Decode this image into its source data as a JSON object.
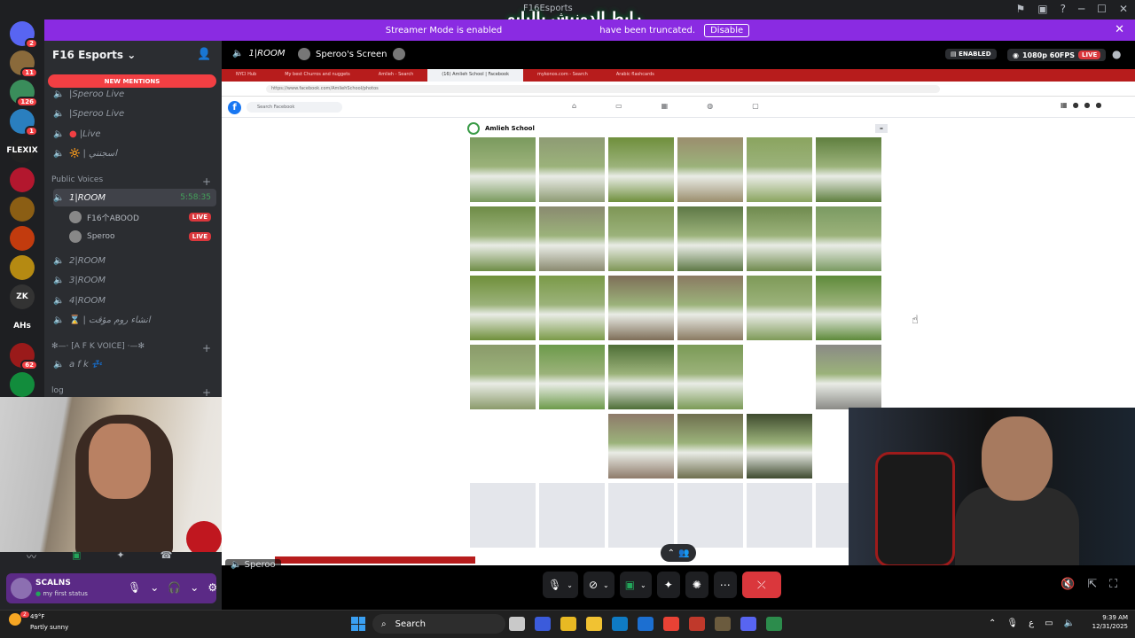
{
  "window": {
    "title": "F16Esports",
    "overlay_logo_text": "رابط الدونيش بالبايو",
    "controls": [
      "inbox-icon",
      "help-icon",
      "minimize",
      "maximize",
      "close"
    ]
  },
  "streamer_mode": {
    "text": "Streamer Mode is enabled. Sensitive details have been truncated.",
    "text_left": "Streamer Mode is enabled",
    "text_right": "have been truncated.",
    "disable_label": "Disable"
  },
  "server_rail": [
    {
      "name": "discord-home",
      "badge": "2",
      "color": "#5865f2"
    },
    {
      "name": "server-1",
      "badge": "11",
      "color": "#8a6a3b"
    },
    {
      "name": "server-2",
      "badge": "126",
      "color": "#3a8d5b"
    },
    {
      "name": "server-3",
      "badge": "1",
      "color": "#2a7fbf"
    },
    {
      "name": "server-4",
      "badge": "",
      "color": "#222222",
      "label": "FLEXIX"
    },
    {
      "name": "server-5",
      "badge": "",
      "color": "#b3172e"
    },
    {
      "name": "server-6",
      "badge": "",
      "color": "#8b5e14"
    },
    {
      "name": "server-7",
      "badge": "",
      "color": "#c23b0e"
    },
    {
      "name": "server-8",
      "badge": "",
      "color": "#b58a12"
    },
    {
      "name": "server-9",
      "badge": "",
      "color": "#333333",
      "label": "ZK"
    },
    {
      "name": "server-10",
      "badge": "",
      "color": "#1e1f22",
      "label": "AHs"
    },
    {
      "name": "server-11",
      "badge": "62",
      "color": "#9a1a1a"
    },
    {
      "name": "server-12",
      "badge": "",
      "color": "#128c3c"
    }
  ],
  "sidebar": {
    "server_name": "F16 Esports",
    "new_mentions": "NEW MENTIONS",
    "channels_top": [
      {
        "label": "|Speroo Live"
      },
      {
        "label": "|Speroo Live"
      },
      {
        "label": "|Live"
      },
      {
        "label": "| اسجنني"
      }
    ],
    "category_public": "Public Voices",
    "active_channel": {
      "label": "1|ROOM",
      "timer": "5:58:35"
    },
    "voice_users": [
      {
        "name": "F16个ABOOD",
        "live": "LIVE"
      },
      {
        "name": "Speroo",
        "live": "LIVE"
      }
    ],
    "rooms": [
      "2|ROOM",
      "3|ROOM",
      "4|ROOM",
      "| انشاء روم مؤقت"
    ],
    "category_afk": "✻—· [A F K VOICE] ·—✻",
    "afk_channel": "a f k",
    "category_log": "log"
  },
  "voice_header": {
    "room": "1|ROOM",
    "screen_label": "Speroo's Screen",
    "enabled_badge": "ENABLED",
    "quality": "1080p 60FPS",
    "live": "LIVE"
  },
  "browser": {
    "tabs": [
      "NYCI Hub",
      "My best Churros and nuggets",
      "Amlieh - Search",
      "(16) Amlieh School | Facebook",
      "mykonos.com - Search",
      "Arabic flashcards"
    ],
    "url": "https://www.facebook.com/AmliehSchool/photos",
    "fb_search_placeholder": "Search Facebook",
    "page_name": "Amlieh School"
  },
  "photos": {
    "rows": [
      [
        "#7a9a5e",
        "#8e9b74",
        "#6f8f3c",
        "#9b8e6e",
        "#8aa45f",
        "#5f7f3f"
      ],
      [
        "#6e8c46",
        "#8a8a70",
        "#7e9656",
        "#5e7846",
        "#6f8a4e",
        "#7a9a62"
      ],
      [
        "#6f8f3a",
        "#7a9a48",
        "#7e6e58",
        "#8a7a62",
        "#7e9a58",
        "#5e8a3a"
      ],
      [
        "#8a9a6a",
        "#6c9a4a",
        "#4e6e36",
        "#7a9a56",
        "",
        "#8a8a86"
      ],
      [
        "",
        "",
        "#8e7a6a",
        "#6e6e4e",
        "#3e4a2e",
        ""
      ]
    ],
    "skeleton_count": 6
  },
  "stream_footer": {
    "user_tag": "Speroo"
  },
  "user_panel": {
    "name": "SCALNS",
    "status": "my first status"
  },
  "taskbar": {
    "temperature": "49°F",
    "weather": "Partly sunny",
    "weather_badge": "2",
    "search_label": "Search",
    "apps": [
      "#c9c9c9",
      "#3b5bdb",
      "#e8b923",
      "#f1c232",
      "#0f7bc4",
      "#1c6fd1",
      "#e94235",
      "#c0392b",
      "#6b5b3e",
      "#5865f2",
      "#2c8c4c"
    ],
    "lang": "ع",
    "time": "9:39 AM",
    "date": "12/31/2025"
  }
}
